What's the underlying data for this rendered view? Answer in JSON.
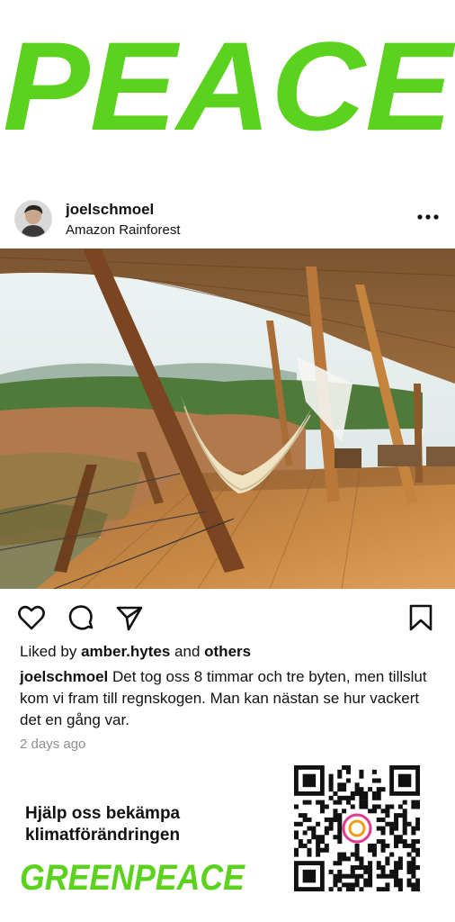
{
  "headline": {
    "text": "PEACE",
    "color": "#5bd21d"
  },
  "post": {
    "username": "joelschmoel",
    "location": "Amazon Rainforest",
    "liked_prefix": "Liked by",
    "liked_user": "amber.hytes",
    "liked_and": "and",
    "liked_others": "others",
    "caption_user": "joelschmoel",
    "caption_text": "Det tog oss 8 timmar och tre byten, men tillslut kom vi fram till regnskogen. Man kan nästan se hur vackert det en gång var.",
    "time": "2 days ago"
  },
  "icons": {
    "more": "more-icon",
    "like": "heart-icon",
    "comment": "comment-icon",
    "share": "send-icon",
    "save": "bookmark-icon"
  },
  "ad": {
    "cta_line1": "Hjälp oss bekämpa",
    "cta_line2": "klimatförändringen",
    "brand": "GREENPEACE",
    "brand_color": "#5bd21d"
  }
}
